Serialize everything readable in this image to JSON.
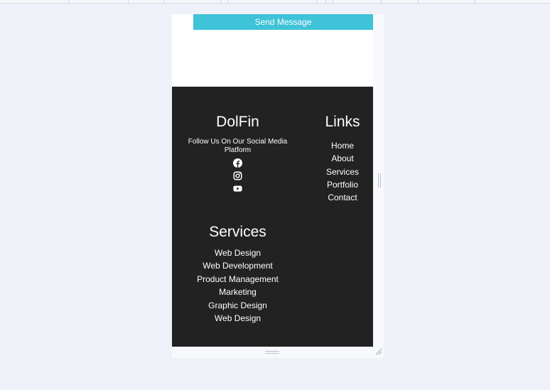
{
  "contact": {
    "send_label": "Send Message"
  },
  "footer": {
    "brand": {
      "title": "DolFin",
      "follow_text": "Follow Us On Our Social Media Platform",
      "socials": [
        {
          "icon": "facebook-icon"
        },
        {
          "icon": "instagram-icon"
        },
        {
          "icon": "youtube-icon"
        }
      ]
    },
    "links": {
      "title": "Links",
      "items": [
        "Home",
        "About",
        "Services",
        "Portfolio",
        "Contact"
      ]
    },
    "services": {
      "title": "Services",
      "items": [
        "Web Design",
        "Web Development",
        "Product Management",
        "Marketing",
        "Graphic Design",
        "Web Design"
      ]
    }
  },
  "colors": {
    "page_background": "#eef1f7",
    "accent": "#3ec3d8",
    "footer_background": "#222222",
    "footer_text": "#ffffff"
  }
}
